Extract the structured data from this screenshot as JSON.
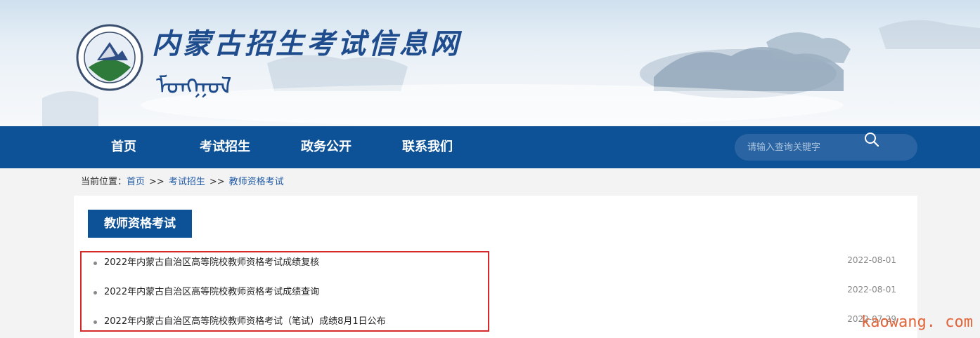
{
  "header": {
    "site_title": "内蒙古招生考试信息网",
    "site_subtitle": "ᠮᠣᠩᠭᠣᠯ",
    "logo_icon": "emblem-logo"
  },
  "nav": {
    "items": [
      {
        "label": "首页"
      },
      {
        "label": "考试招生"
      },
      {
        "label": "政务公开"
      },
      {
        "label": "联系我们"
      }
    ],
    "search": {
      "placeholder": "请输入查询关键字",
      "icon": "search-icon"
    }
  },
  "breadcrumb": {
    "prefix": "当前位置：",
    "items": [
      "首页",
      "考试招生",
      "教师资格考试"
    ],
    "separator": ">>"
  },
  "section": {
    "title": "教师资格考试",
    "news": [
      {
        "title": "2022年内蒙古自治区高等院校教师资格考试成绩复核",
        "date": "2022-08-01"
      },
      {
        "title": "2022年内蒙古自治区高等院校教师资格考试成绩查询",
        "date": "2022-08-01"
      },
      {
        "title": "2022年内蒙古自治区高等院校教师资格考试（笔试）成绩8月1日公布",
        "date": "2022-07-29"
      }
    ]
  },
  "watermark": "kaowang. com",
  "colors": {
    "nav_bg": "#0d5196",
    "highlight": "#d42a2a",
    "link": "#1f5aa6"
  }
}
